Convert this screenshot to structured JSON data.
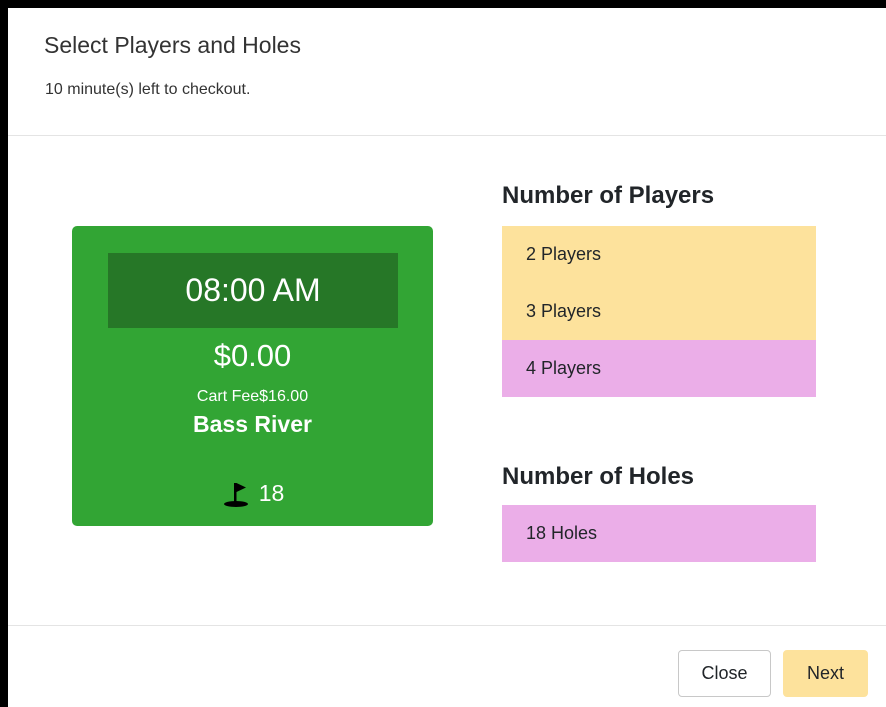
{
  "modal": {
    "title": "Select Players and Holes",
    "subtitle": "10 minute(s) left to checkout."
  },
  "tee_time": {
    "time": "08:00 AM",
    "price": "$0.00",
    "cart_fee_label": "Cart Fee",
    "cart_fee_value": "$16.00",
    "course": "Bass River",
    "holes": "18",
    "icon": "golf-flag-icon",
    "card_color": "#32a534",
    "time_box_color": "#267727"
  },
  "players": {
    "title": "Number of Players",
    "options": [
      {
        "label": "2 Players",
        "selected": false
      },
      {
        "label": "3 Players",
        "selected": false
      },
      {
        "label": "4 Players",
        "selected": true
      }
    ]
  },
  "holes": {
    "title": "Number of Holes",
    "options": [
      {
        "label": "18 Holes",
        "selected": true
      }
    ]
  },
  "colors": {
    "option_default": "#fde29c",
    "option_selected": "#ebaee8",
    "next_button": "#fde29c"
  },
  "footer": {
    "close_label": "Close",
    "next_label": "Next"
  }
}
